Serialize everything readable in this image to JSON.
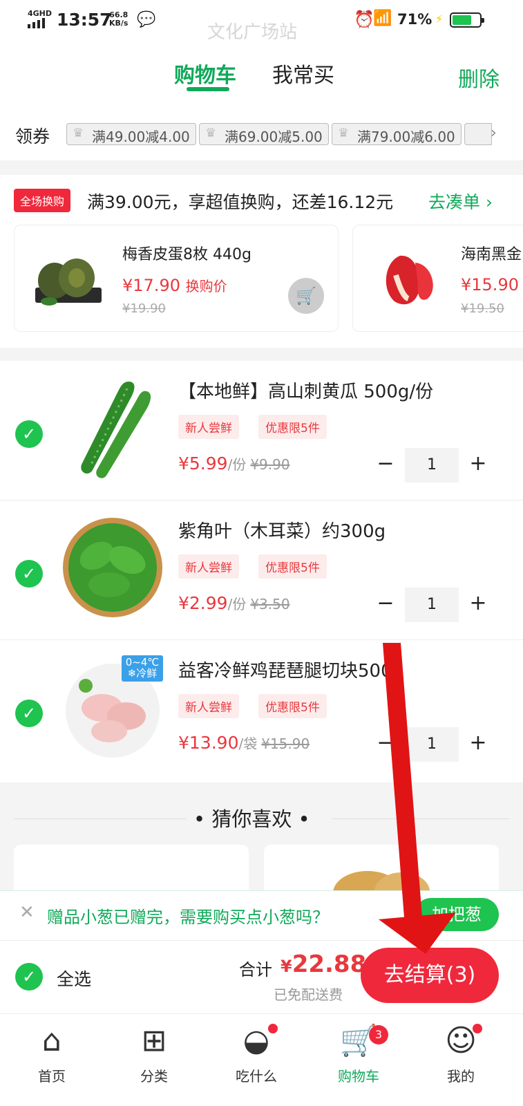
{
  "status_bar": {
    "network": "4GHD",
    "time": "13:57",
    "speed_value": "66.8",
    "speed_unit": "KB/s",
    "station": "文化广场站",
    "battery_pct": "71%"
  },
  "header": {
    "tab_cart": "购物车",
    "tab_often": "我常买",
    "delete": "删除"
  },
  "coupons": {
    "label": "领券",
    "items": [
      "满49.00减4.00",
      "满69.00减5.00",
      "满79.00减6.00"
    ]
  },
  "exchange": {
    "badge": "全场换购",
    "message": "满39.00元，享超值换购，还差16.12元",
    "link": "去凑单 ›",
    "cards": [
      {
        "name": "梅香皮蛋8枚 440g",
        "price": "¥17.90",
        "price_note": "换购价",
        "orig": "¥19.90"
      },
      {
        "name": "海南黑金",
        "price": "¥15.90",
        "orig": "¥19.50"
      }
    ]
  },
  "items": [
    {
      "title": "【本地鲜】高山刺黄瓜 500g/份",
      "tag1": "新人尝鲜",
      "tag2": "优惠限5件",
      "price": "¥5.99",
      "unit": "/份",
      "orig": "¥9.90",
      "qty": "1"
    },
    {
      "title": "紫角叶（木耳菜）约300g",
      "tag1": "新人尝鲜",
      "tag2": "优惠限5件",
      "price": "¥2.99",
      "unit": "/份",
      "orig": "¥3.50",
      "qty": "1"
    },
    {
      "title": "益客冷鲜鸡琵琶腿切块500g",
      "tag1": "新人尝鲜",
      "tag2": "优惠限5件",
      "price": "¥13.90",
      "unit": "/袋",
      "orig": "¥15.90",
      "qty": "1",
      "cold_temp": "0~4℃",
      "cold_label": "❄冷鲜"
    }
  ],
  "recommend": {
    "title": "猜你喜欢"
  },
  "notice": {
    "text": "赠品小葱已赠完，需要购买点小葱吗？",
    "button": "加把葱"
  },
  "checkout": {
    "select_all": "全选",
    "total_label": "合计",
    "currency": "¥",
    "total": "22.88",
    "delivery": "已免配送费",
    "pay_button": "去结算(3)"
  },
  "nav": {
    "items": [
      {
        "label": "首页",
        "icon": "home-icon"
      },
      {
        "label": "分类",
        "icon": "category-icon"
      },
      {
        "label": "吃什么",
        "icon": "bowl-icon"
      },
      {
        "label": "购物车",
        "icon": "cart-icon",
        "badge": "3"
      },
      {
        "label": "我的",
        "icon": "user-icon"
      }
    ]
  },
  "colors": {
    "accent_green": "#10a95a",
    "price_red": "#e8383d",
    "pay_red": "#f0283c"
  }
}
